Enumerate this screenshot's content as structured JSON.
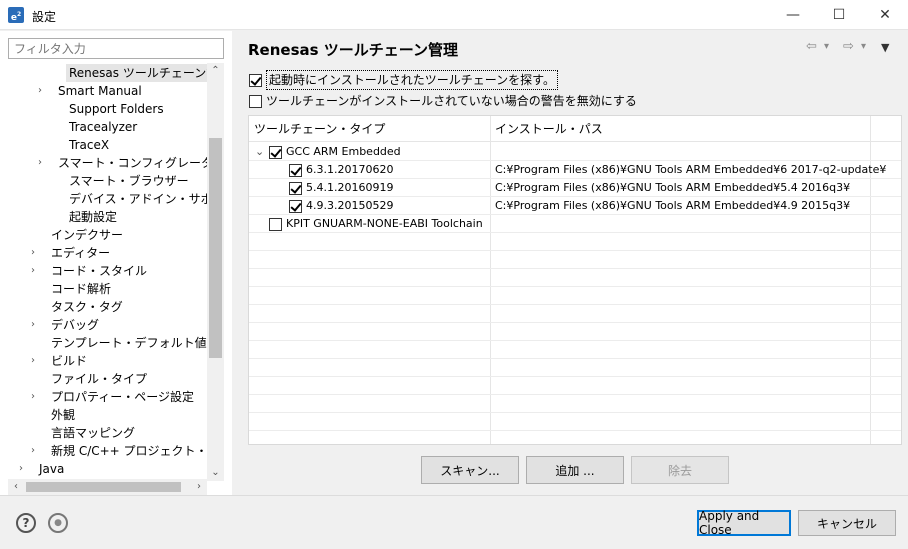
{
  "window": {
    "icon_text": "e",
    "title": "設定",
    "minimize": "—",
    "maximize": "☐",
    "close": "✕"
  },
  "filter": {
    "placeholder": "フィルタ入力"
  },
  "tree": [
    {
      "label": "Renesas ツールチェーン管理",
      "chevron": "",
      "selected": true
    },
    {
      "label": "Smart Manual",
      "chevron": "›"
    },
    {
      "label": "Support Folders",
      "chevron": ""
    },
    {
      "label": "Tracealyzer",
      "chevron": ""
    },
    {
      "label": "TraceX",
      "chevron": ""
    },
    {
      "label": "スマート・コンフィグレータ",
      "chevron": "›"
    },
    {
      "label": "スマート・ブラウザー",
      "chevron": ""
    },
    {
      "label": "デバイス・アドイン・サポート",
      "chevron": ""
    },
    {
      "label": "起動設定",
      "chevron": ""
    },
    {
      "label": "インデクサー",
      "chevron": ""
    },
    {
      "label": "エディター",
      "chevron": "›"
    },
    {
      "label": "コード・スタイル",
      "chevron": "›"
    },
    {
      "label": "コード解析",
      "chevron": ""
    },
    {
      "label": "タスク・タグ",
      "chevron": ""
    },
    {
      "label": "デバッグ",
      "chevron": "›"
    },
    {
      "label": "テンプレート・デフォルト値",
      "chevron": ""
    },
    {
      "label": "ビルド",
      "chevron": "›"
    },
    {
      "label": "ファイル・タイプ",
      "chevron": ""
    },
    {
      "label": "プロパティー・ページ設定",
      "chevron": "›"
    },
    {
      "label": "外観",
      "chevron": ""
    },
    {
      "label": "言語マッピング",
      "chevron": ""
    },
    {
      "label": "新規 C/C++ プロジェクト・ウィザー",
      "chevron": "›"
    },
    {
      "label": "Java",
      "chevron": "›"
    }
  ],
  "scroll": {
    "up": "⌃",
    "down": "⌄",
    "left": "‹",
    "right": "›"
  },
  "page": {
    "title": "Renesas ツールチェーン管理",
    "nav_back": "⇦",
    "nav_forward": "⇨",
    "nav_dropdown": "▾",
    "menu": "▼"
  },
  "options": [
    {
      "label": "起動時にインストールされたツールチェーンを探す。",
      "checked": true
    },
    {
      "label": "ツールチェーンがインストールされていない場合の警告を無効にする",
      "checked": false
    }
  ],
  "table": {
    "headers": [
      "ツールチェーン・タイプ",
      "インストール・パス"
    ],
    "rows": [
      {
        "name": "GCC ARM Embedded",
        "path": "",
        "checked": true,
        "level": 0,
        "expander": "⌄"
      },
      {
        "name": "6.3.1.20170620",
        "path": "C:¥Program Files (x86)¥GNU Tools ARM Embedded¥6 2017-q2-update¥",
        "checked": true,
        "level": 1,
        "expander": ""
      },
      {
        "name": "5.4.1.20160919",
        "path": "C:¥Program Files (x86)¥GNU Tools ARM Embedded¥5.4 2016q3¥",
        "checked": true,
        "level": 1,
        "expander": ""
      },
      {
        "name": "4.9.3.20150529",
        "path": "C:¥Program Files (x86)¥GNU Tools ARM Embedded¥4.9 2015q3¥",
        "checked": true,
        "level": 1,
        "expander": ""
      },
      {
        "name": "KPIT GNUARM-NONE-EABI Toolchain",
        "path": "",
        "checked": false,
        "level": 0,
        "expander": ""
      }
    ]
  },
  "buttons": {
    "scan": "スキャン...",
    "add": "追加 ...",
    "remove": "除去",
    "apply_close": "Apply and Close",
    "cancel": "キャンセル"
  },
  "bottom": {
    "help": "?",
    "prefs": "●"
  }
}
